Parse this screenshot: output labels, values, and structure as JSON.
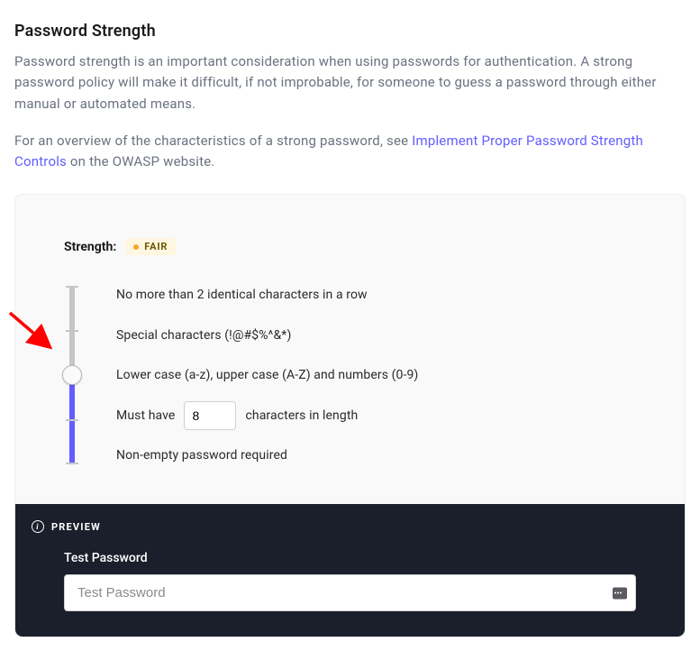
{
  "heading": "Password Strength",
  "description": "Password strength is an important consideration when using passwords for authentication. A strong password policy will make it difficult, if not improbable, for someone to guess a password through either manual or automated means.",
  "overview_prefix": "For an overview of the characteristics of a strong password, see ",
  "overview_link": "Implement Proper Password Strength Controls",
  "overview_suffix": " on the OWASP website.",
  "strength": {
    "label": "Strength:",
    "badge": "FAIR"
  },
  "levels": {
    "l0": "No more than 2 identical characters in a row",
    "l1": "Special characters (!@#$%^&*)",
    "l2": "Lower case (a-z), upper case (A-Z) and numbers (0-9)",
    "l3_prefix": "Must have",
    "l3_value": "8",
    "l3_suffix": "characters in length",
    "l4": "Non-empty password required"
  },
  "preview": {
    "header": "PREVIEW",
    "label": "Test Password",
    "placeholder": "Test Password"
  }
}
